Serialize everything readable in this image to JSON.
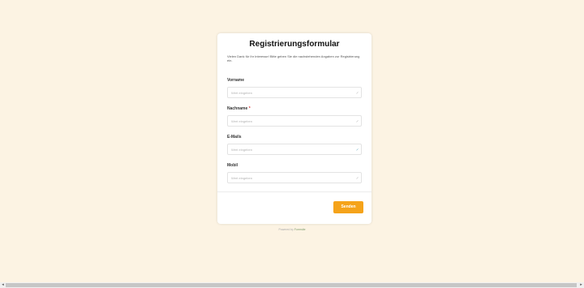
{
  "form": {
    "title": "Registrierungsformular",
    "intro": "Vielen Dank für Ihr Interesse! Bitte geben Sie die nachstehenden Angaben zur Registrierung ein.",
    "fields": [
      {
        "label": "Vorname",
        "required": false,
        "placeholder": "Wert eingeben",
        "icon": "magic-wand-icon"
      },
      {
        "label": "Nachname",
        "required": true,
        "placeholder": "Wert eingeben",
        "icon": "magic-wand-icon"
      },
      {
        "label": "E-Mails",
        "required": false,
        "placeholder": "Wert eingeben",
        "icon": "magic-wand-icon"
      },
      {
        "label": "Mobil",
        "required": false,
        "placeholder": "Wert eingeben",
        "icon": "magic-wand-icon"
      }
    ],
    "required_marker": "*",
    "submit_label": "Senden"
  },
  "footer": {
    "powered_prefix": "Powered by",
    "powered_brand": "Formsite"
  },
  "colors": {
    "page_background": "#fcf3e3",
    "accent": "#f5a31a",
    "required": "#dd3333"
  },
  "scrollbar": {
    "left_arrow": "◂",
    "right_arrow": "▸"
  }
}
